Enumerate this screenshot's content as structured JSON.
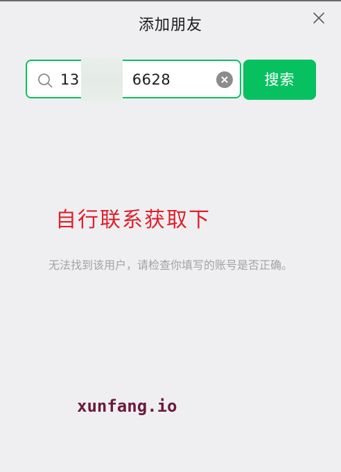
{
  "header": {
    "title": "添加朋友"
  },
  "search": {
    "value_prefix": "13",
    "value_suffix": "6628",
    "button_label": "搜索"
  },
  "overlay": {
    "red_text": "自行联系获取下",
    "site_text": "xunfang.io"
  },
  "result": {
    "message": "无法找到该用户，请检查你填写的账号是否正确。"
  },
  "colors": {
    "accent": "#07c160",
    "background": "#efeff2",
    "watermark_red": "#e0202a"
  },
  "icons": {
    "close": "close-icon",
    "search": "search-icon",
    "clear": "clear-circle-icon"
  }
}
